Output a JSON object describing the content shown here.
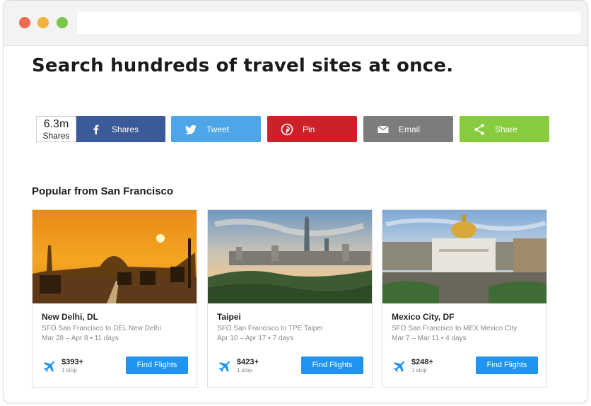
{
  "headline": "Search hundreds of travel sites at once.",
  "share_count": {
    "number": "6.3m",
    "label": "Shares"
  },
  "share_buttons": [
    {
      "label": "Shares",
      "icon": "facebook-icon",
      "color": "#3b5a9a"
    },
    {
      "label": "Tweet",
      "icon": "twitter-icon",
      "color": "#4ea6e8"
    },
    {
      "label": "Pin",
      "icon": "pinterest-icon",
      "color": "#cc2128"
    },
    {
      "label": "Email",
      "icon": "email-icon",
      "color": "#7b7d7b"
    },
    {
      "label": "Share",
      "icon": "share-icon",
      "color": "#86cc3c"
    }
  ],
  "section_title": "Popular from San Francisco",
  "cards": [
    {
      "city": "New Delhi, DL",
      "route": "SFO San Francisco to DEL New Delhi",
      "dates": "Mar 28 – Apr 8 • 11 days",
      "price": "$393+",
      "stops": "1 stop",
      "button": "Find Flights",
      "photo": "new-delhi-sunset-photo"
    },
    {
      "city": "Taipei",
      "route": "SFO San Francisco to TPE Taipei",
      "dates": "Apr 10 – Apr 17 • 7 days",
      "price": "$423+",
      "stops": "1 stop",
      "button": "Find Flights",
      "photo": "taipei-skyline-photo"
    },
    {
      "city": "Mexico City, DF",
      "route": "SFO San Francisco to MEX Mexico City",
      "dates": "Mar 7 – Mar 11 • 4 days",
      "price": "$248+",
      "stops": "1 stop",
      "button": "Find Flights",
      "photo": "mexico-city-palace-photo"
    }
  ],
  "colors": {
    "accent_blue": "#2194f0",
    "text_muted": "#8a8a8a"
  }
}
